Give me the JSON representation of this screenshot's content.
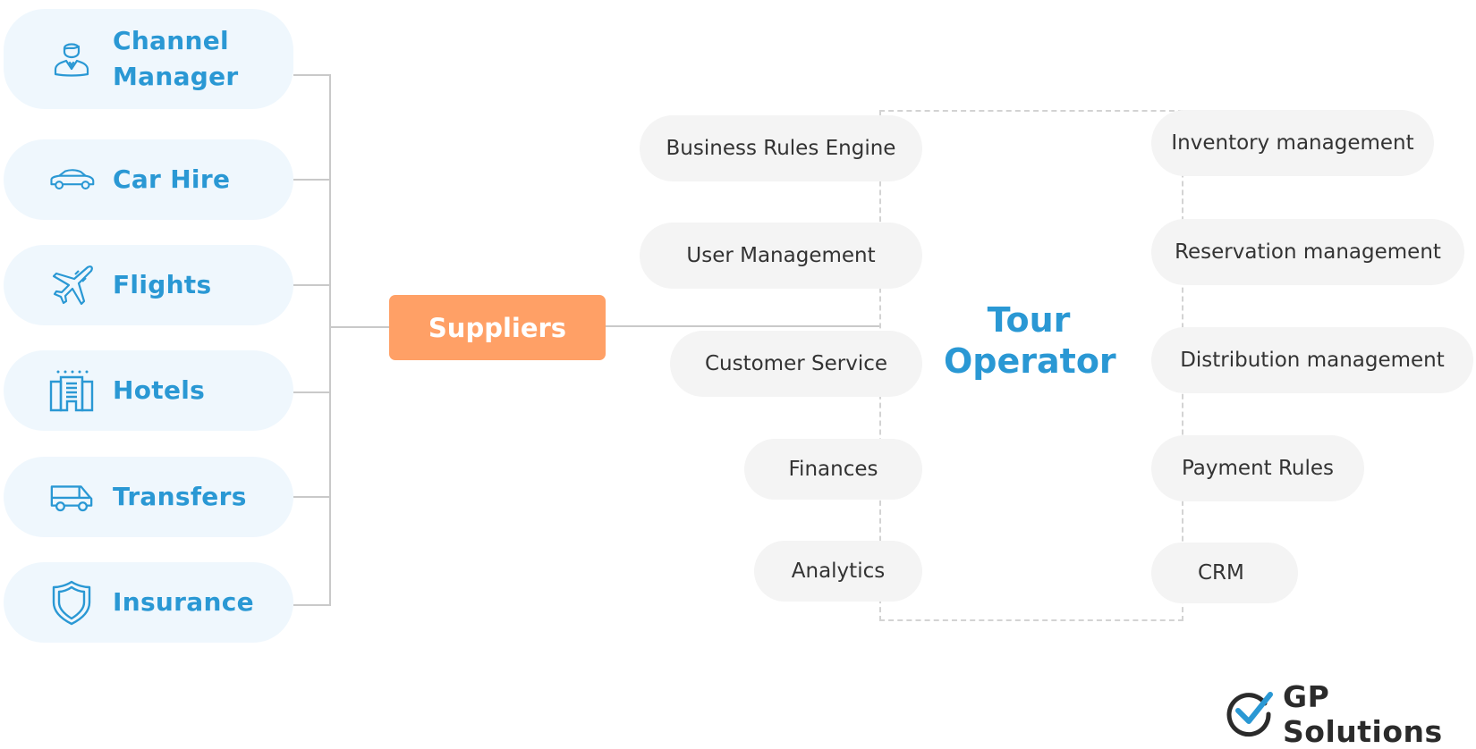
{
  "colors": {
    "accent_blue": "#2a98d4",
    "supplier_bg": "#eff7fd",
    "hub_orange": "#ffa066",
    "module_bg": "#f4f4f4",
    "connector_gray": "#c9c9c9"
  },
  "suppliers": [
    {
      "label_line1": "Channel",
      "label_line2": "Manager",
      "icon": "manager-icon"
    },
    {
      "label": "Car Hire",
      "icon": "car-icon"
    },
    {
      "label": "Flights",
      "icon": "airplane-icon"
    },
    {
      "label": "Hotels",
      "icon": "hotel-icon"
    },
    {
      "label": "Transfers",
      "icon": "van-icon"
    },
    {
      "label": "Insurance",
      "icon": "shield-icon"
    }
  ],
  "hub": {
    "label": "Suppliers"
  },
  "tour_operator": {
    "line1": "Tour",
    "line2": "Operator"
  },
  "left_modules": [
    {
      "label": "Business Rules Engine"
    },
    {
      "label": "User Management"
    },
    {
      "label": "Customer Service"
    },
    {
      "label": "Finances"
    },
    {
      "label": "Analytics"
    }
  ],
  "right_modules": [
    {
      "label": "Inventory management"
    },
    {
      "label": "Reservation management"
    },
    {
      "label": "Distribution management"
    },
    {
      "label": "Payment Rules"
    },
    {
      "label": "CRM"
    }
  ],
  "logo": {
    "text": "GP Solutions",
    "icon": "checkmark-circle-icon"
  }
}
